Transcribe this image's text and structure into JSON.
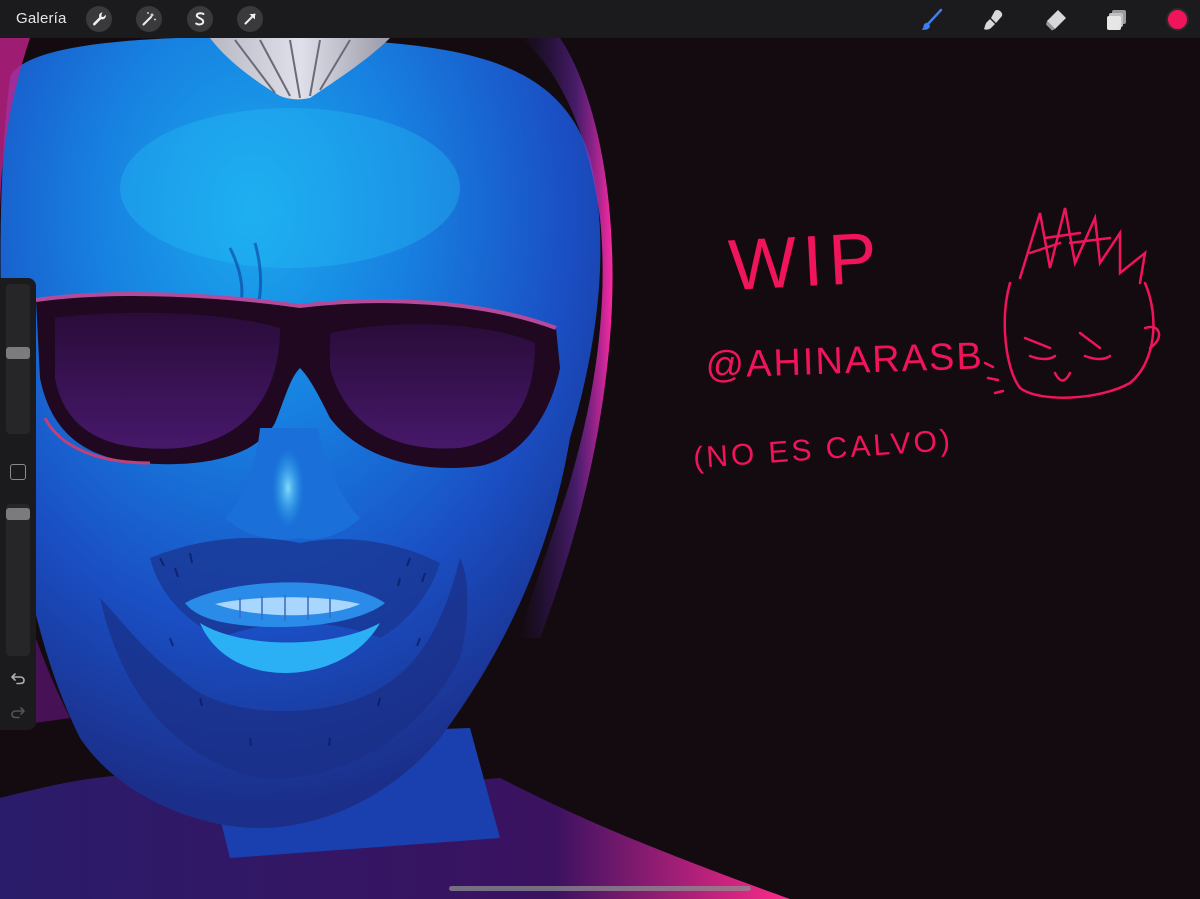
{
  "toolbar": {
    "gallery_label": "Galería",
    "left_tools": [
      {
        "icon": "wrench-icon",
        "name": "actions"
      },
      {
        "icon": "magic-wand-icon",
        "name": "adjustments"
      },
      {
        "icon": "selection-icon",
        "name": "selection"
      },
      {
        "icon": "arrow-cursor-icon",
        "name": "transform"
      }
    ],
    "right_tools": [
      {
        "icon": "brush-icon",
        "name": "paint",
        "active": true
      },
      {
        "icon": "smudge-icon",
        "name": "smudge"
      },
      {
        "icon": "eraser-icon",
        "name": "eraser"
      },
      {
        "icon": "layers-icon",
        "name": "layers"
      }
    ],
    "current_color": "#f0145a",
    "active_tool_color": "#3d7ff0"
  },
  "sidebar": {
    "brush_size_level": 0.54,
    "opacity_level": 0.97,
    "undo_icon": "undo-icon",
    "redo_icon": "redo-icon"
  },
  "canvas": {
    "background_color": "#140b10",
    "annotation_color": "#f0145a",
    "handwritten_text": {
      "line1": "WIP",
      "line2": "@AHINARASB",
      "line3": "(NO ES CALVO)"
    }
  }
}
